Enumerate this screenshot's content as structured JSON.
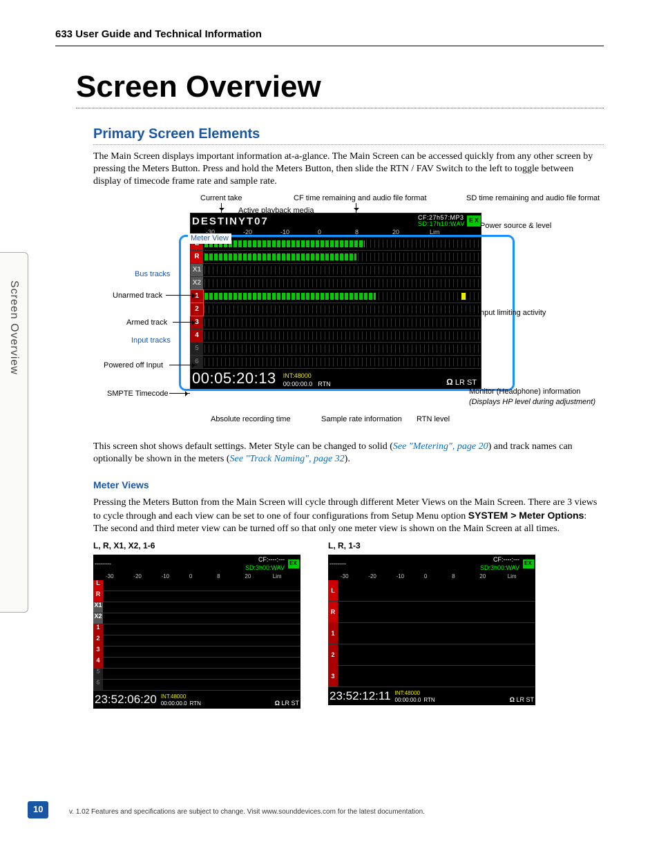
{
  "header": {
    "title": "633 User Guide and Technical Information"
  },
  "h1": "Screen Overview",
  "h2_primary": "Primary Screen Elements",
  "para1": "The Main Screen displays important information at-a-glance. The Main Screen can be accessed quickly from any other screen by pressing the Meters Button. Press and hold the Meters Button, then slide the RTN / FAV Switch to the left to toggle between display of timecode frame rate and sample rate.",
  "diagram": {
    "callouts": {
      "current_take": "Current take",
      "cf_remaining": "CF time remaining and audio file format",
      "sd_remaining": "SD time remaining and audio file format",
      "active_playback": "Active playback media",
      "power_source": "Power source & level",
      "meter_view": "Meter View",
      "bus_tracks": "Bus tracks",
      "unarmed_track": "Unarmed track",
      "armed_track": "Armed track",
      "input_tracks": "Input tracks",
      "powered_off_input": "Powered off Input",
      "smpte": "SMPTE Timecode",
      "input_limiting": "Input limiting activity",
      "monitor_hp": "Monitor (Headphone) information",
      "monitor_hp_note": "(Displays HP level during adjustment)",
      "abs_rec_time": "Absolute recording time",
      "sample_rate_info": "Sample rate information",
      "rtn_level": "RTN level"
    },
    "screen": {
      "take": "DESTINYT07",
      "cf": "CF:27h57:MP3",
      "sd": "SD:17h10:WAV",
      "power_icon_label": "EX",
      "scale": [
        "-30",
        "-20",
        "-10",
        "0",
        "8",
        "20",
        "Lim"
      ],
      "tracks": [
        "L",
        "R",
        "X1",
        "X2",
        "1",
        "2",
        "3",
        "4",
        "5",
        "6"
      ],
      "smpte": "00:05:20:13",
      "sample_rate": "INT:48000",
      "abs_time": "00:00:00.0",
      "rtn": "RTN",
      "monitor": "Ω LR ST"
    }
  },
  "para2_pre": "This screen shot shows default settings. Meter Style can be changed to solid (",
  "link1": "See \"Metering\", page 20",
  "para2_mid": ") and track names can optionally be shown in the meters (",
  "link2": "See \"Track Naming\", page 32",
  "para2_post": ").",
  "h3_meterviews": "Meter Views",
  "para3_pre": "Pressing the Meters Button from the Main Screen will cycle through different Meter Views on the Main Screen. There are 3 views to cycle through and each view can be set to one of four configurations from Setup Menu option ",
  "para3_bold": "SYSTEM > Meter Options",
  "para3_post": ": The second and third meter view can be turned off so that only one meter view is shown on the Main Screen at all times.",
  "meter_view_left": {
    "title": "L, R, X1, X2, 1-6",
    "cf": "CF:----:---",
    "sd": "SD:3h00:WAV",
    "scale": [
      "-30",
      "-20",
      "-10",
      "0",
      "8",
      "20",
      "Lim"
    ],
    "tracks": [
      "L",
      "R",
      "X1",
      "X2",
      "1",
      "2",
      "3",
      "4",
      "5",
      "6"
    ],
    "tc": "23:52:06:20",
    "sample_rate": "INT:48000",
    "abs": "00:00:00.0",
    "rtn": "RTN",
    "mon": "Ω LR ST"
  },
  "meter_view_right": {
    "title": "L, R, 1-3",
    "cf": "CF:----:---",
    "sd": "SD:3h00:WAV",
    "scale": [
      "-30",
      "-20",
      "-10",
      "0",
      "8",
      "20",
      "Lim"
    ],
    "tracks": [
      "L",
      "R",
      "1",
      "2",
      "3"
    ],
    "tc": "23:52:12:11",
    "sample_rate": "INT:48000",
    "abs": "00:00:00.0",
    "rtn": "RTN",
    "mon": "Ω LR ST"
  },
  "side_tab": "Screen Overview",
  "page_number": "10",
  "footer": "v. 1.02     Features and specifications are subject to change. Visit www.sounddevices.com for the latest documentation."
}
